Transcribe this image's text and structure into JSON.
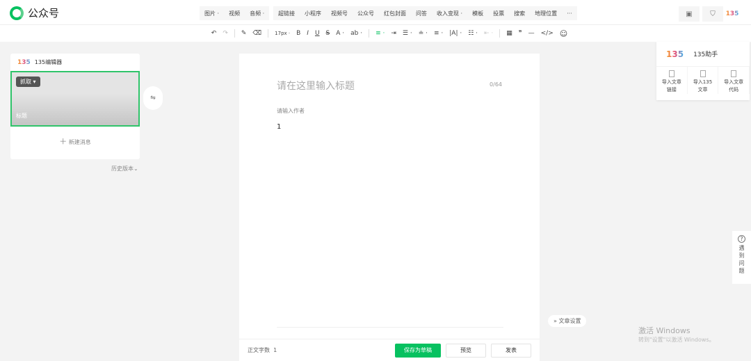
{
  "header": {
    "app_title": "公众号",
    "insert_group1": [
      "图片 ·",
      "视频",
      "音频 ·"
    ],
    "insert_group2": [
      "超链接",
      "小程序",
      "视频号",
      "公众号",
      "红包封面",
      "问答",
      "收入变现 ·",
      "模板",
      "投票",
      "搜索",
      "地理位置",
      "···"
    ],
    "right_logo": "135"
  },
  "format_toolbar": {
    "undo": "↶",
    "redo": "↷",
    "format_painter": "✎",
    "clear": "⌫",
    "font_size": "17px ·",
    "bold": "B",
    "italic": "I",
    "underline": "U",
    "strike": "S",
    "font_color": "A ·",
    "bg_color": "ab ·",
    "align": "≡ ·",
    "indent": "⇥",
    "spacing": "☰ ·",
    "para": "≐ ·",
    "line_h": "≡ ·",
    "letter": "|A| ·",
    "list": "☷ ·",
    "rtl": "⇤ ·",
    "table": "▦",
    "quote": "❞",
    "hr": "—",
    "code": "</>",
    "emoji": "☺"
  },
  "left_panel": {
    "editor_logo": "135",
    "editor_name": "135编辑器",
    "grab_label": "抓取",
    "cover_title": "标题",
    "new_message": "新建消息",
    "history": "历史版本"
  },
  "editor": {
    "title_placeholder": "请在这里输入标题",
    "title_count": "0/64",
    "author_placeholder": "请输入作者",
    "body": "1",
    "word_count_label": "正文字数",
    "word_count": "1",
    "save_draft": "保存为草稿",
    "preview": "预览",
    "publish": "发表"
  },
  "helper": {
    "logo": "135",
    "title": "135助手",
    "items": [
      "导入文章\n链接",
      "导入135\n文章",
      "导入文章\n代码"
    ]
  },
  "article_settings": "文章设置",
  "help": {
    "icon": "?",
    "label": [
      "遇",
      "到",
      "问",
      "题"
    ]
  },
  "watermark": {
    "line1": "激活 Windows",
    "line2": "转到\"设置\"以激活 Windows。"
  }
}
